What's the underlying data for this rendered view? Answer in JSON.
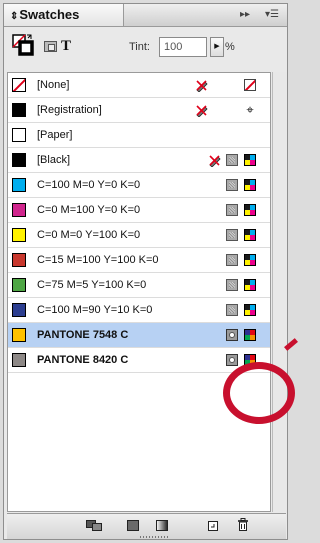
{
  "panel": {
    "tab_label": "Swatches",
    "tab_twisty": "⇕",
    "menu_arrows": "▸▸",
    "menu_icon": "▾☰"
  },
  "toolbar": {
    "t_glyph": "T",
    "tint_label": "Tint:",
    "tint_value": "100",
    "tint_stepper": "▶",
    "percent": "%"
  },
  "swatches": [
    {
      "name": "[None]",
      "color": "none",
      "icons": [
        "pencil-x-icon",
        "none-swatch-icon"
      ]
    },
    {
      "name": "[Registration]",
      "color": "#000000",
      "icons": [
        "pencil-x-icon",
        "registration-mark-icon"
      ]
    },
    {
      "name": "[Paper]",
      "color": "#ffffff",
      "icons": []
    },
    {
      "name": "[Black]",
      "color": "#000000",
      "icons": [
        "pencil-x-icon",
        "process-color-icon",
        "cmyk-mode-icon"
      ]
    },
    {
      "name": "C=100 M=0 Y=0 K=0",
      "color": "#00aeef",
      "icons": [
        "process-color-icon",
        "cmyk-mode-icon"
      ]
    },
    {
      "name": "C=0 M=100 Y=0 K=0",
      "color": "#d0258d",
      "icons": [
        "process-color-icon",
        "cmyk-mode-icon"
      ]
    },
    {
      "name": "C=0 M=0 Y=100 K=0",
      "color": "#fff200",
      "icons": [
        "process-color-icon",
        "cmyk-mode-icon"
      ]
    },
    {
      "name": "C=15 M=100 Y=100 K=0",
      "color": "#c8372d",
      "icons": [
        "process-color-icon",
        "cmyk-mode-icon"
      ]
    },
    {
      "name": "C=75 M=5 Y=100 K=0",
      "color": "#4ea644",
      "icons": [
        "process-color-icon",
        "cmyk-mode-icon"
      ]
    },
    {
      "name": "C=100 M=90 Y=10 K=0",
      "color": "#2c3e90",
      "icons": [
        "process-color-icon",
        "cmyk-mode-icon"
      ]
    },
    {
      "name": "PANTONE 7548 C",
      "color": "#ffc200",
      "selected": true,
      "spot": true,
      "icons": [
        "spot-color-icon",
        "rgb-mode-icon"
      ]
    },
    {
      "name": "PANTONE 8420 C",
      "color": "#8d8886",
      "spot": true,
      "icons": [
        "spot-color-icon",
        "rgb-mode-icon"
      ]
    }
  ],
  "highlight_color": "#c8102e",
  "bottom_icons": [
    "show-all-swatches-icon",
    "show-color-swatches-icon",
    "show-gradient-swatches-icon",
    "new-swatch-icon",
    "delete-swatch-icon"
  ]
}
